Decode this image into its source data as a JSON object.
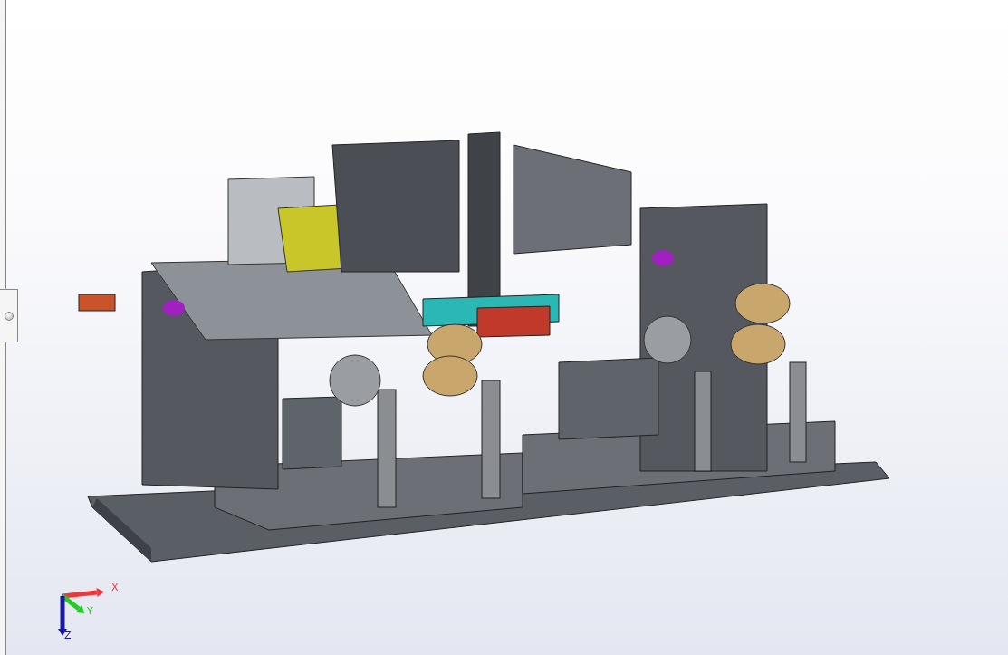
{
  "viewport": {
    "triad": {
      "axes": [
        {
          "label": "X",
          "color": "#e83a3a"
        },
        {
          "label": "Y",
          "color": "#22cc22"
        },
        {
          "label": "Z",
          "color": "#1a1aa0"
        }
      ]
    }
  }
}
